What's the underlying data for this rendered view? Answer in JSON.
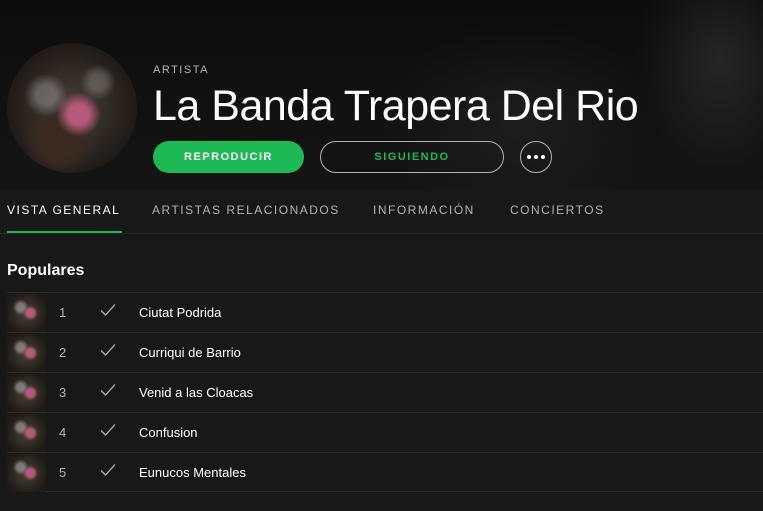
{
  "header": {
    "kicker": "ARTISTA",
    "artist_name": "La Banda Trapera Del Rio",
    "play_label": "REPRODUCIR",
    "follow_label": "SIGUIENDO"
  },
  "tabs": [
    {
      "label": "VISTA GENERAL",
      "active": true
    },
    {
      "label": "ARTISTAS RELACIONADOS",
      "active": false
    },
    {
      "label": "INFORMACIÓN",
      "active": false
    },
    {
      "label": "CONCIERTOS",
      "active": false
    }
  ],
  "popular": {
    "title": "Populares",
    "tracks": [
      {
        "number": "1",
        "title": "Ciutat Podrida"
      },
      {
        "number": "2",
        "title": "Curriqui de Barrio"
      },
      {
        "number": "3",
        "title": "Venid a las Cloacas"
      },
      {
        "number": "4",
        "title": "Confusion"
      },
      {
        "number": "5",
        "title": "Eunucos Mentales"
      }
    ]
  },
  "colors": {
    "accent": "#1db954",
    "background": "#181818",
    "muted_text": "#b3b3b3"
  },
  "icons": {
    "more": "more-options-icon",
    "saved": "checkmark-icon"
  }
}
